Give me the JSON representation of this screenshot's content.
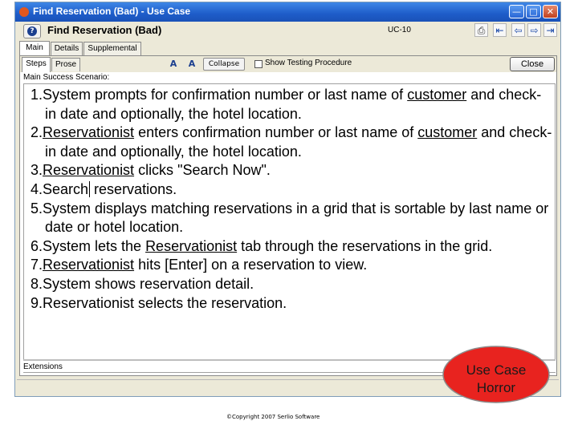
{
  "window": {
    "title": "Find Reservation (Bad) - Use Case",
    "controls": {
      "minimize": "—",
      "maximize": "□",
      "close": "✕"
    }
  },
  "header": {
    "use_case_title": "Find Reservation (Bad)",
    "use_case_id": "UC-10",
    "icons": [
      "help-icon",
      "print-icon",
      "first-icon",
      "prev-icon",
      "next-icon",
      "last-icon"
    ]
  },
  "tabs": [
    "Main",
    "Details",
    "Supplemental"
  ],
  "subtabs": [
    "Steps",
    "Prose"
  ],
  "toolbar": {
    "collapse_label": "Collapse",
    "show_testing_label": "Show Testing Procedure",
    "show_testing_checked": false,
    "close_label": "Close"
  },
  "scenario": {
    "label": "Main Success Scenario:",
    "steps": [
      {
        "parts": [
          {
            "t": "1.System prompts for confirmation number or last name of "
          },
          {
            "t": "customer",
            "u": true
          },
          {
            "t": " and check-in date and optionally, the hotel location."
          }
        ]
      },
      {
        "parts": [
          {
            "t": "2."
          },
          {
            "t": "Reservationist",
            "u": true
          },
          {
            "t": " enters confirmation number or last name of "
          },
          {
            "t": "customer",
            "u": true
          },
          {
            "t": " and check-in date and optionally, the hotel location."
          }
        ]
      },
      {
        "parts": [
          {
            "t": "3."
          },
          {
            "t": "Reservationist",
            "u": true
          },
          {
            "t": " clicks \"Search Now\"."
          }
        ]
      },
      {
        "parts": [
          {
            "t": "4.Search"
          },
          {
            "t": "",
            "caret": true
          },
          {
            "t": " reservations."
          }
        ]
      },
      {
        "parts": [
          {
            "t": "5.System displays matching reservations in a grid that is sortable by last name or date or hotel location."
          }
        ]
      },
      {
        "parts": [
          {
            "t": "6.System lets the "
          },
          {
            "t": "Reservationist",
            "u": true
          },
          {
            "t": " tab through the reservations in the grid."
          }
        ]
      },
      {
        "parts": [
          {
            "t": "7."
          },
          {
            "t": "Reservationist",
            "u": true
          },
          {
            "t": " hits [Enter] on a reservation to view."
          }
        ]
      },
      {
        "parts": [
          {
            "t": "8.System shows reservation detail."
          }
        ]
      },
      {
        "parts": [
          {
            "t": "9.Reservationist selects the reservation."
          }
        ]
      }
    ]
  },
  "extensions": {
    "label": "Extensions"
  },
  "badge": {
    "line1": "Use Case",
    "line2": "Horror",
    "color": "#e8231f"
  },
  "footer": {
    "copyright": "©Copyright 2007 Serlio Software"
  }
}
